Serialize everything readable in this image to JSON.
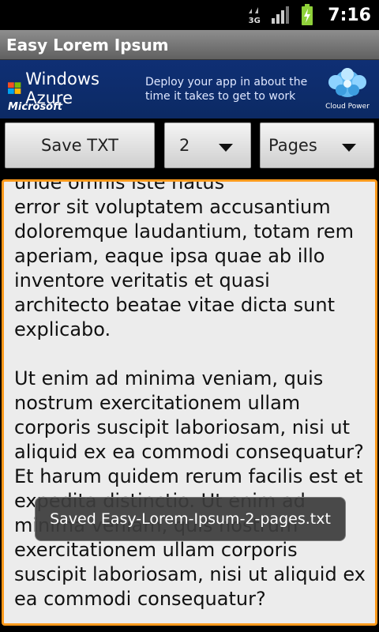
{
  "status_bar": {
    "network": "3G",
    "time": "7:16",
    "icons": [
      "network-3g-icon",
      "signal-icon",
      "battery-icon"
    ]
  },
  "app": {
    "title": "Easy Lorem Ipsum"
  },
  "ad": {
    "brand": "Windows Azure",
    "company": "Microsoft",
    "tagline": "Deploy your app in about the time it takes to get to work",
    "badge": "Cloud Power",
    "accent": "#0f2f74"
  },
  "toolbar": {
    "save_label": "Save TXT",
    "count_value": "2",
    "unit_value": "Pages"
  },
  "editor": {
    "text": "unde omnis iste natus\nerror sit voluptatem accusantium doloremque laudantium, totam rem aperiam, eaque ipsa quae ab illo inventore veritatis et quasi architecto beatae vitae dicta sunt explicabo.\n\nUt enim ad minima veniam, quis nostrum exercitationem ullam corporis suscipit laboriosam, nisi ut aliquid ex ea commodi consequatur?  Et harum quidem rerum facilis est et expedita distinctio. Ut enim ad minima veniam, quis nostrum exercitationem ullam corporis suscipit laboriosam, nisi ut aliquid ex ea commodi consequatur?",
    "focus_color": "#ff9a1c"
  },
  "toast": {
    "message": "Saved Easy-Lorem-Ipsum-2-pages.txt"
  }
}
